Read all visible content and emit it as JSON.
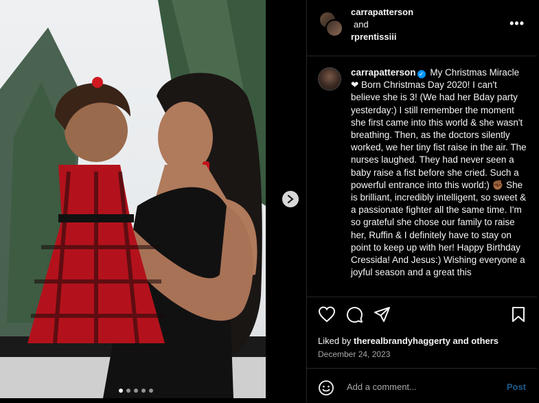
{
  "header": {
    "user1": "carrapatterson",
    "and_text": "and",
    "user2": "rprentissiii",
    "more": "•••"
  },
  "caption": {
    "username": "carrapatterson",
    "verified_badge": "✓",
    "text": "My Christmas Miracle ❤ Born Christmas Day 2020! I can't believe she is 3! (We had her Bday party yesterday:) I still remember the moment she first came into this world & she wasn't breathing. Then, as the doctors silently worked, we her tiny fist raise in the air. The nurses laughed. They had never seen a baby raise a fist before she cried. Such a powerful entrance into this world:) ✊🏾 She is brilliant, incredibly intelligent, so sweet & a passionate fighter all the same time. I'm so grateful she chose our family to raise her, Ruffin & I definitely have to stay on point to keep up with her! Happy Birthday Cressida! And Jesus:) Wishing everyone a joyful season and a great this"
  },
  "actions": {
    "like_icon": "heart-icon",
    "comment_icon": "comment-icon",
    "share_icon": "share-icon",
    "save_icon": "bookmark-icon"
  },
  "likes": {
    "prefix": "Liked by",
    "user": "therealbrandyhaggerty",
    "conj": "and",
    "others": "others"
  },
  "date": "December 24, 2023",
  "comment": {
    "placeholder": "Add a comment...",
    "post_label": "Post"
  },
  "carousel": {
    "next_icon": "chevron-right-icon",
    "current": 1,
    "total": 5
  },
  "colors": {
    "background": "#000000",
    "verified": "#0095f6",
    "post_disabled": "#1e5a8a"
  }
}
